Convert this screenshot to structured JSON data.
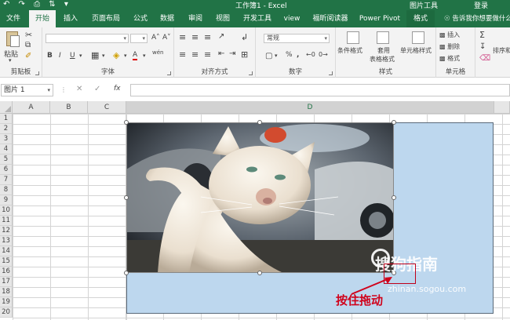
{
  "titlebar": {
    "quick_access": "↶ ↷ ⎙ ⇅ ▾",
    "window_title": "工作簿1 - Excel",
    "context_tab_group": "图片工具",
    "login": "登录"
  },
  "tabs": [
    {
      "label": "文件"
    },
    {
      "label": "开始"
    },
    {
      "label": "插入"
    },
    {
      "label": "页面布局"
    },
    {
      "label": "公式"
    },
    {
      "label": "数据"
    },
    {
      "label": "审阅"
    },
    {
      "label": "视图"
    },
    {
      "label": "开发工具"
    },
    {
      "label": "view"
    },
    {
      "label": "福昕阅读器"
    },
    {
      "label": "Power Pivot"
    },
    {
      "label": "格式"
    }
  ],
  "tell_me": "告诉我你想要做什么",
  "ribbon": {
    "clipboard": {
      "paste_label": "粘贴",
      "group_label": "剪贴板"
    },
    "font": {
      "group_label": "字体",
      "bold": "B",
      "italic": "I",
      "underline": "U",
      "grow": "A˄",
      "shrink": "A˅",
      "font_color": "A",
      "wen": "wén"
    },
    "alignment": {
      "group_label": "对齐方式"
    },
    "number": {
      "format_value": "常规",
      "group_label": "数字",
      "percent": "%",
      "comma": ","
    },
    "styles": {
      "group_label": "样式",
      "conditional": "条件格式",
      "table_format_1": "套用",
      "table_format_2": "表格格式",
      "cell_styles": "单元格样式"
    },
    "cells": {
      "group_label": "单元格",
      "insert": "插入",
      "delete": "删除",
      "format": "格式"
    },
    "editing": {
      "sum": "Σ",
      "sort_filter": "排序和"
    }
  },
  "formula_bar": {
    "name_box": "图片 1",
    "cancel": "✕",
    "enter": "✓",
    "fx": "fx",
    "value": ""
  },
  "grid": {
    "columns": [
      "A",
      "B",
      "C",
      "D"
    ],
    "rows": [
      "1",
      "2",
      "3",
      "4",
      "5",
      "6",
      "7",
      "8",
      "9",
      "10",
      "11",
      "12",
      "13",
      "14",
      "15",
      "16",
      "17",
      "18",
      "19",
      "20"
    ]
  },
  "overlay": {
    "annotation": "按住拖动",
    "watermark": "搜狗指南",
    "watermark_url": "zhinan.sogou.com"
  }
}
